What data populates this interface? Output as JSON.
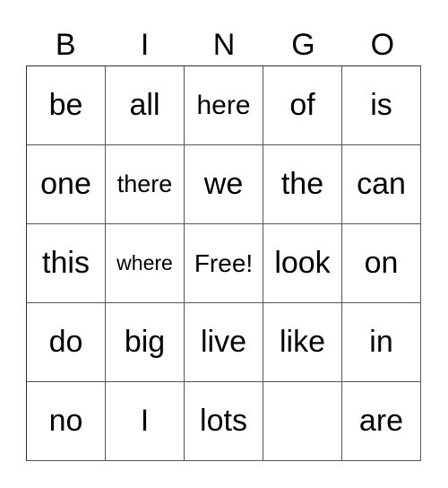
{
  "header": [
    "B",
    "I",
    "N",
    "G",
    "O"
  ],
  "rows": [
    [
      "be",
      "all",
      "here",
      "of",
      "is"
    ],
    [
      "one",
      "there",
      "we",
      "the",
      "can"
    ],
    [
      "this",
      "where",
      "Free!",
      "look",
      "on"
    ],
    [
      "do",
      "big",
      "live",
      "like",
      "in"
    ],
    [
      "no",
      "I",
      "lots",
      "",
      "are"
    ]
  ]
}
